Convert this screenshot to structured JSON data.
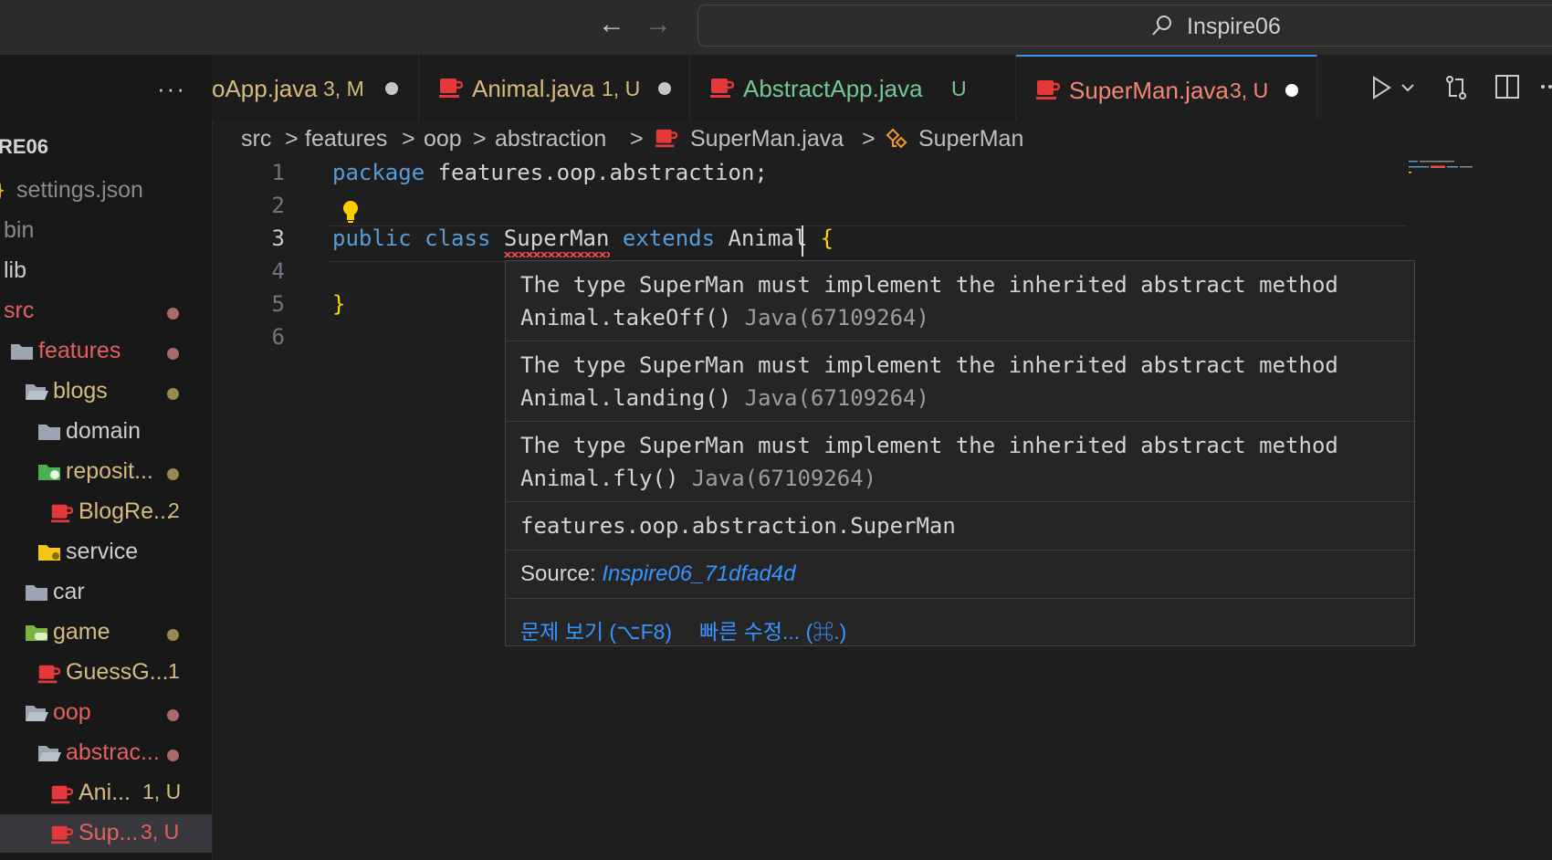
{
  "titlebar": {
    "back_arrow": "←",
    "forward_arrow": "→",
    "search_text": "Inspire06"
  },
  "sidebar": {
    "more_dots": "···",
    "header_title": "RE06",
    "items": [
      {
        "label": "settings.json",
        "icon": "json-file-icon",
        "color": "#8b8b8b"
      },
      {
        "label": "bin",
        "icon": "none",
        "color": "#8b8b8b"
      },
      {
        "label": "lib",
        "icon": "none",
        "color": "#cccccc"
      },
      {
        "label": "src",
        "icon": "none",
        "color": "#e2625e"
      },
      {
        "label": "features",
        "icon": "folder-icon",
        "color": "#e2625e"
      },
      {
        "label": "blogs",
        "icon": "folder-open-icon",
        "color": "#d7ba7d"
      },
      {
        "label": "domain",
        "icon": "folder-icon",
        "color": "#cccccc"
      },
      {
        "label": "reposit...",
        "icon": "repository-folder-icon",
        "color": "#d7ba7d"
      },
      {
        "label": "BlogRe...",
        "badge": "2",
        "icon": "java-file-icon",
        "color": "#d7ba7d"
      },
      {
        "label": "service",
        "icon": "service-folder-icon",
        "color": "#cccccc"
      },
      {
        "label": "car",
        "icon": "folder-icon",
        "color": "#cccccc"
      },
      {
        "label": "game",
        "icon": "game-folder-icon",
        "color": "#d7ba7d"
      },
      {
        "label": "GuessG...",
        "badge": "1",
        "icon": "java-file-icon",
        "color": "#d7ba7d"
      },
      {
        "label": "oop",
        "icon": "folder-open-icon",
        "color": "#e2625e"
      },
      {
        "label": "abstrac...",
        "icon": "folder-open-icon",
        "color": "#e2625e"
      },
      {
        "label": "Ani...",
        "badge": "1, U",
        "icon": "java-file-icon",
        "color": "#d7ba7d"
      },
      {
        "label": "Sup...",
        "badge": "3, U",
        "icon": "java-file-icon",
        "color": "#e2625e"
      }
    ]
  },
  "tabs": [
    {
      "label": "oApp.java",
      "badge": "3, M",
      "color": "#d7ba7d"
    },
    {
      "label": "Animal.java",
      "badge": "1, U",
      "color": "#d7ba7d"
    },
    {
      "label": "AbstractApp.java",
      "badge": "U",
      "color": "#73c991"
    },
    {
      "label": "SuperMan.java",
      "badge": "3, U",
      "color": "#f48771"
    }
  ],
  "breadcrumb": {
    "parts": [
      "src",
      "features",
      "oop",
      "abstraction",
      "SuperMan.java",
      "SuperMan"
    ],
    "separator": ">"
  },
  "editor": {
    "line_numbers": [
      "1",
      "2",
      "3",
      "4",
      "5",
      "6"
    ],
    "line1_kw": "package",
    "line1_rest": " features.oop.abstraction;",
    "line3_kw1": "public",
    "line3_kw2": "class",
    "line3_name": "SuperMan",
    "line3_kw3": "extends",
    "line3_parent": "Animal",
    "line3_brace": "{",
    "line5_brace": "}"
  },
  "hover": {
    "errors": [
      {
        "line1": "The type SuperMan must implement the inherited abstract method",
        "line2": "Animal.takeOff()",
        "code": "Java(67109264)"
      },
      {
        "line1": "The type SuperMan must implement the inherited abstract method",
        "line2": "Animal.landing()",
        "code": "Java(67109264)"
      },
      {
        "line1": "The type SuperMan must implement the inherited abstract method",
        "line2": "Animal.fly()",
        "code": "Java(67109264)"
      }
    ],
    "qualified_name": "features.oop.abstraction.SuperMan",
    "source_label": "Source:",
    "source_link": "Inspire06_71dfad4d",
    "action_problem": "문제 보기 (⌥F8)",
    "action_quickfix": "빠른 수정... (⌘.)"
  },
  "colors": {
    "accent": "#3b8eea",
    "error": "#f14c4c",
    "keyword": "#569cd6",
    "link": "#3794ff"
  }
}
